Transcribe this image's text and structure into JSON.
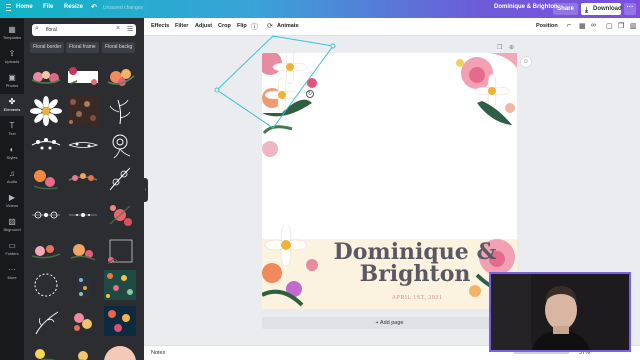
{
  "topbar": {
    "home": "Home",
    "file": "File",
    "resize": "Resize",
    "unsaved": "Unsaved changes",
    "doc_title": "Dominique & Brighton",
    "share": "Share",
    "download": "Download",
    "more": "···"
  },
  "rail": [
    {
      "icon": "▦",
      "label": "Templates"
    },
    {
      "icon": "⇪",
      "label": "Uploads"
    },
    {
      "icon": "▣",
      "label": "Photos"
    },
    {
      "icon": "✤",
      "label": "Elements"
    },
    {
      "icon": "T",
      "label": "Text"
    },
    {
      "icon": "◐",
      "label": "Styles"
    },
    {
      "icon": "♫",
      "label": "Audio"
    },
    {
      "icon": "▶",
      "label": "Videos"
    },
    {
      "icon": "▨",
      "label": "Bkground"
    },
    {
      "icon": "▭",
      "label": "Folders"
    },
    {
      "icon": "···",
      "label": "More"
    }
  ],
  "panel": {
    "search_value": "floral",
    "chips": [
      "Floral border",
      "Floral frame",
      "Floral backg"
    ]
  },
  "toolbar": {
    "effects": "Effects",
    "filter": "Filter",
    "adjust": "Adjust",
    "crop": "Crop",
    "flip": "Flip",
    "info": "ⓘ",
    "animate": "Animate",
    "position": "Position"
  },
  "canvas": {
    "name_line1": "Dominique &",
    "name_line2": "Brighton",
    "date": "APRIL 1ST, 2021",
    "add_page": "+ Add page"
  },
  "bottombar": {
    "notes": "Notes",
    "zoom": "37%"
  },
  "colors": {
    "accent": "#7d2ae8",
    "banner": "#fbf3df",
    "date_pink": "#d48aa4"
  }
}
